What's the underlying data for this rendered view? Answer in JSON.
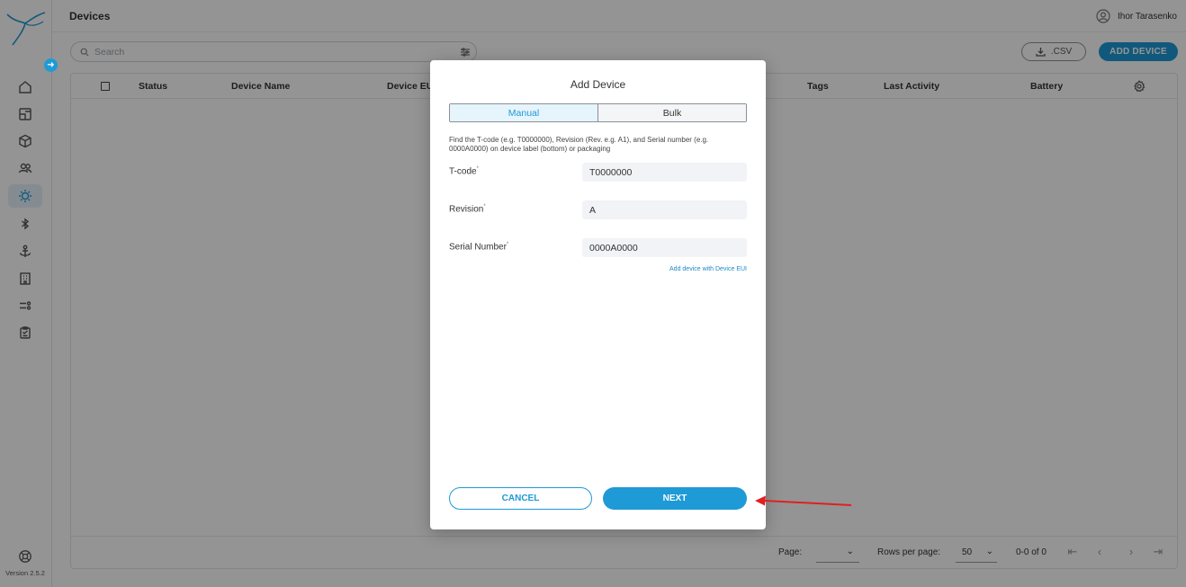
{
  "app": {
    "version": "Version 2.5.2",
    "accent_color": "#1e9ad6"
  },
  "sidebar": {
    "collapse_icon": "arrow-right-icon",
    "items": [
      {
        "icon": "home-icon",
        "active": false
      },
      {
        "icon": "dashboard-icon",
        "active": false
      },
      {
        "icon": "cube-icon",
        "active": false
      },
      {
        "icon": "users-icon",
        "active": false
      },
      {
        "icon": "device-chip-icon",
        "active": true
      },
      {
        "icon": "bluetooth-icon",
        "active": false
      },
      {
        "icon": "anchor-icon",
        "active": false
      },
      {
        "icon": "building-icon",
        "active": false
      },
      {
        "icon": "rules-icon",
        "active": false
      },
      {
        "icon": "reports-icon",
        "active": false
      }
    ],
    "help_icon": "lifebuoy-icon"
  },
  "header": {
    "title": "Devices",
    "user_name": "Ihor Tarasenko"
  },
  "toolbar": {
    "search_placeholder": "Search",
    "csv_label": ".CSV",
    "add_device_label": "ADD DEVICE"
  },
  "table": {
    "columns": [
      "Status",
      "Device Name",
      "Device EUI",
      "Tags",
      "Last Activity",
      "Battery"
    ],
    "rows": []
  },
  "pagination": {
    "page_label": "Page:",
    "rows_per_page_label": "Rows per page:",
    "rows_per_page_value": "50",
    "range_text": "0-0 of 0"
  },
  "modal": {
    "title": "Add Device",
    "tabs": [
      "Manual",
      "Bulk"
    ],
    "active_tab": "Manual",
    "hint": "Find the T-code (e.g. T0000000), Revision (Rev. e.g. A1), and Serial number (e.g. 0000A0000) on device label (bottom) or packaging",
    "fields": [
      {
        "label": "T-code",
        "required_mark": "*",
        "value": "T0000000"
      },
      {
        "label": "Revision",
        "required_mark": "*",
        "value": "A"
      },
      {
        "label": "Serial Number",
        "required_mark": "*",
        "value": "0000A0000"
      }
    ],
    "eui_link": "Add device with Device EUI",
    "cancel_label": "CANCEL",
    "next_label": "NEXT"
  },
  "annotation": {
    "arrow_color": "#e02020"
  }
}
